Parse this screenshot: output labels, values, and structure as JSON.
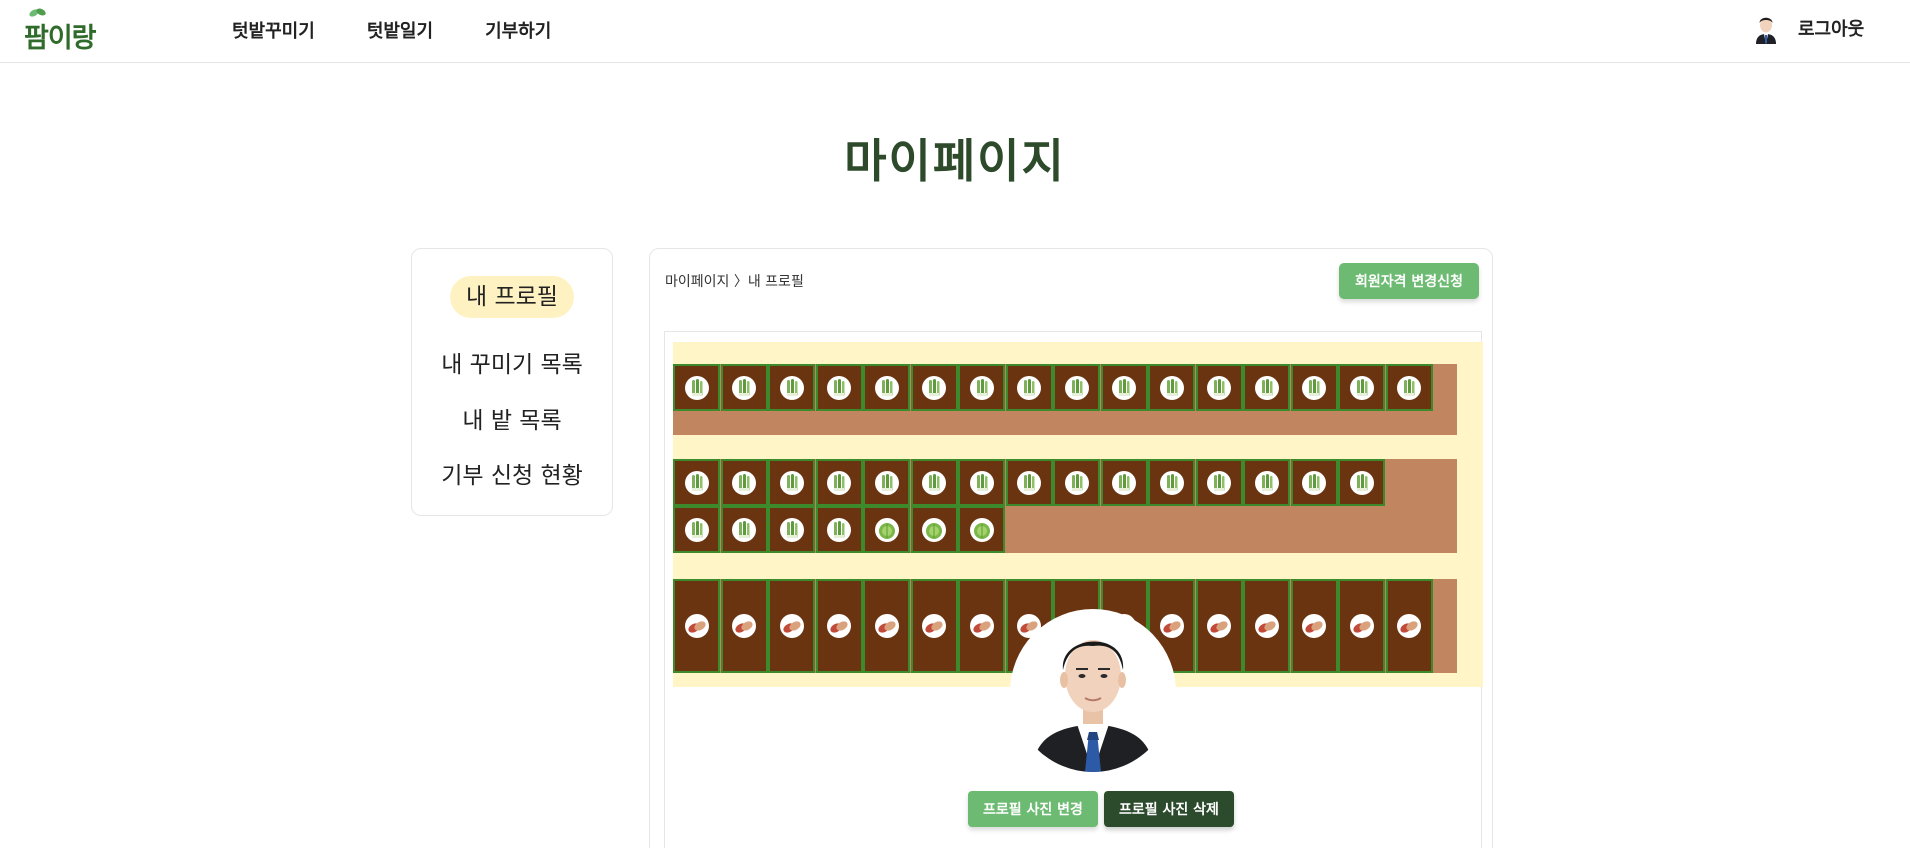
{
  "header": {
    "logo_text": "팜이랑",
    "nav": [
      "텃밭꾸미기",
      "텃밭일기",
      "기부하기"
    ],
    "logout_label": "로그아웃"
  },
  "page_title": "마이페이지",
  "sidebar": {
    "items": [
      {
        "label": "내 프로필",
        "active": true
      },
      {
        "label": "내 꾸미기 목록",
        "active": false
      },
      {
        "label": "내 밭 목록",
        "active": false
      },
      {
        "label": "기부 신청 현황",
        "active": false
      }
    ]
  },
  "main": {
    "breadcrumb": "마이페이지 〉내 프로필",
    "change_membership_label": "회원자격 변경신청",
    "farm_rows": [
      {
        "crops": [
          "green-onion",
          "green-onion",
          "green-onion",
          "green-onion",
          "green-onion",
          "green-onion",
          "green-onion",
          "green-onion",
          "green-onion",
          "green-onion",
          "green-onion",
          "green-onion",
          "green-onion",
          "green-onion",
          "green-onion",
          "green-onion"
        ]
      },
      {
        "crops": [
          "green-onion",
          "green-onion",
          "green-onion",
          "green-onion",
          "green-onion",
          "green-onion",
          "green-onion",
          "green-onion",
          "green-onion",
          "green-onion",
          "green-onion",
          "green-onion",
          "green-onion",
          "green-onion",
          "green-onion"
        ]
      },
      {
        "crops": [
          "green-onion",
          "green-onion",
          "green-onion",
          "green-onion",
          "lettuce",
          "lettuce",
          "lettuce"
        ]
      },
      {
        "crops": [
          "sweet-potato",
          "sweet-potato",
          "sweet-potato",
          "sweet-potato",
          "sweet-potato",
          "sweet-potato",
          "sweet-potato",
          "sweet-potato",
          "sweet-potato",
          "sweet-potato",
          "sweet-potato",
          "sweet-potato",
          "sweet-potato",
          "sweet-potato",
          "sweet-potato",
          "sweet-potato"
        ]
      }
    ],
    "change_photo_label": "프로필 사진 변경",
    "delete_photo_label": "프로필 사진 삭제"
  },
  "colors": {
    "brand_green": "#6dbb72",
    "dark_green": "#2c4a2c",
    "title_green": "#2d4a2b",
    "soil": "#6b3411",
    "path": "#c1855f",
    "yard": "#fff5c6",
    "active_tab": "#fff2c2"
  }
}
